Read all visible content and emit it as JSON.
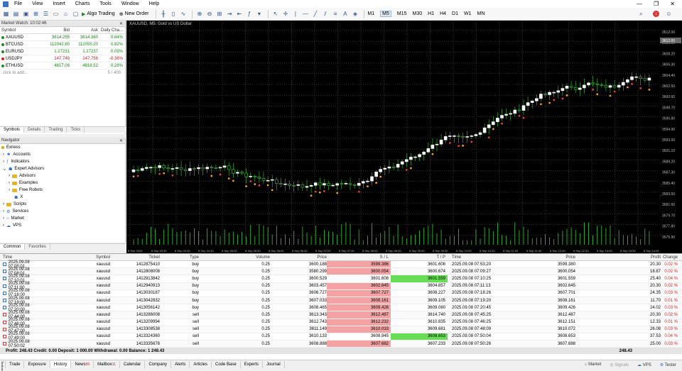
{
  "menu": [
    "File",
    "View",
    "Insert",
    "Charts",
    "Tools",
    "Window",
    "Help"
  ],
  "toolbar": {
    "algo": "Algo Trading",
    "neworder": "New Order",
    "timeframes": [
      "M1",
      "M5",
      "M15",
      "M30",
      "H1",
      "H4",
      "D1",
      "W1",
      "MN"
    ],
    "active_tf": "M5",
    "notifications": "1"
  },
  "market_watch": {
    "title": "Market Watch: 10:02:46",
    "headers": [
      "Symbol",
      "Bid",
      "Ask",
      "Daily Cha..."
    ],
    "rows": [
      {
        "symbol": "XAUUSD",
        "bid": "3614.255",
        "ask": "3614.360",
        "chg": "0.64%",
        "pos": true
      },
      {
        "symbol": "BTCUSD",
        "bid": "112042.60",
        "ask": "112055.20",
        "chg": "0.82%",
        "pos": true
      },
      {
        "symbol": "EURUSD",
        "bid": "1.17231",
        "ask": "1.17237",
        "chg": "0.09%",
        "pos": true
      },
      {
        "symbol": "USDJPY",
        "bid": "147.748",
        "ask": "147.756",
        "chg": "-0.36%",
        "pos": false
      },
      {
        "symbol": "ETHUSD",
        "bid": "4817.06",
        "ask": "4818.52",
        "chg": "0.28%",
        "pos": true
      }
    ],
    "add": "click to add...",
    "count": "5 / 400",
    "tabs": [
      "Symbols",
      "Details",
      "Trading",
      "Ticks"
    ]
  },
  "navigator": {
    "title": "Navigator",
    "root": "Exness",
    "items": [
      "Accounts",
      "Indicators",
      "Expert Advisors",
      "Advisors",
      "Examples",
      "Free Robots",
      "X",
      "Scripts",
      "Services",
      "Market",
      "VPS"
    ],
    "tabs": [
      "Common",
      "Favorites"
    ]
  },
  "chart": {
    "title": "XAUUSD, M5: Gold vs US Dollar",
    "prices": [
      "3612.00",
      "3610.10",
      "3608.20",
      "3606.30",
      "3604.40",
      "3602.50",
      "3600.60",
      "3598.70",
      "3596.80",
      "3594.90",
      "3593.00",
      "3591.10",
      "3589.20",
      "3587.30",
      "3585.40",
      "3583.50",
      "3581.60",
      "3579.70",
      "3577.80",
      "3575.90"
    ],
    "current": "3612.00",
    "times": [
      "8 Sep 2025",
      "8 Sep 03:30",
      "8 Sep 04:00",
      "8 Sep 04:30",
      "8 Sep 05:00",
      "8 Sep 05:30",
      "8 Sep 06:00",
      "8 Sep 06:30",
      "8 Sep 07:00",
      "8 Sep 07:30",
      "8 Sep 08:00",
      "8 Sep 08:30",
      "8 Sep 09:00",
      "8 Sep 09:30",
      "8 Sep 10:00",
      "8 Sep 10:30",
      "8 Sep 11:00",
      "8 Sep 11:30",
      "8 Sep 12:00",
      "8 Sep 12:30",
      "8 Sep 13:00",
      "8 Sep 13:30",
      "8 Sep 14:00"
    ]
  },
  "history": {
    "headers": [
      "Time",
      "Symbol",
      "Ticket",
      "Type",
      "Volume",
      "Price",
      "S / L",
      "T / P",
      "Time",
      "Price",
      "Profit",
      "Change"
    ],
    "rows": [
      [
        "2025.09.08 07:05:01",
        "xauusd",
        "1412875410",
        "buy",
        "0.25",
        "3600.188",
        "3599.386",
        "3601.608",
        "2025.09.08 07:53:20",
        "3599.380",
        "20.30",
        "0.02 %",
        "sl"
      ],
      [
        "2025.09.08 07:08:01",
        "xauusd",
        "1412808008",
        "buy",
        "0.25",
        "3580.299",
        "3600.054",
        "3600.674",
        "2025.09.08 07:09:27",
        "3600.054",
        "18.87",
        "0.02 %",
        "sl"
      ],
      [
        "2025.09.08 07:10:01",
        "xauusd",
        "1412913842",
        "buy",
        "0.25",
        "3600.529",
        "3601.608",
        "3601.559",
        "2025.09.08 07:10:25",
        "3601.559",
        "25.40",
        "0.04 %",
        "tp"
      ],
      [
        "2025.09.08 07:11:00",
        "xauusd",
        "1412940913",
        "buy",
        "0.25",
        "3603.457",
        "3602.645",
        "3604.857",
        "2025.09.08 07:11:13",
        "3602.645",
        "20.30",
        "0.02 %",
        "sl"
      ],
      [
        "2025.09.08 07:16:00",
        "xauusd",
        "1413030187",
        "buy",
        "0.25",
        "3606.727",
        "3607.727",
        "3608.227",
        "2025.09.08 07:18:26",
        "3607.701",
        "24.35",
        "0.03 %",
        "sl"
      ],
      [
        "2025.09.08 07:19:00",
        "xauusd",
        "1413042832",
        "buy",
        "0.25",
        "3607.033",
        "3608.161",
        "3609.105",
        "2025.09.08 07:19:20",
        "3608.161",
        "11.70",
        "0.01 %",
        "sl"
      ],
      [
        "2025.09.08 07:20:00",
        "xauusd",
        "1413056142",
        "buy",
        "0.25",
        "3608.465",
        "3609.426",
        "3609.080",
        "2025.09.08 07:20:45",
        "3609.426",
        "24.02",
        "0.03 %",
        "sl"
      ],
      [
        "2025.09.08 07:44:00",
        "xauusd",
        "1413286008",
        "sell",
        "0.25",
        "3613.343",
        "3612.487",
        "3614.740",
        "2025.09.08 07:45:25",
        "3612.487",
        "20.30",
        "0.02 %",
        "sl"
      ],
      [
        "2025.09.08 07:46:00",
        "xauusd",
        "1413209994",
        "sell",
        "0.25",
        "3612.743",
        "3612.232",
        "3610.835",
        "2025.09.08 07:46:25",
        "3612.151",
        "12.33",
        "0.01 %",
        "sl"
      ],
      [
        "2025.09.08 07:47:00",
        "xauusd",
        "1413308538",
        "sell",
        "0.25",
        "3611.149",
        "3610.033",
        "3609.681",
        "2025.09.08 07:48:09",
        "3610.072",
        "26.08",
        "0.03 %",
        "sl"
      ],
      [
        "2025.09.08 07:49:00",
        "xauusd",
        "1413324360",
        "sell",
        "0.25",
        "3610.133",
        "3608.945",
        "3608.653",
        "2025.09.08 07:50:04",
        "3608.653",
        "37.53",
        "0.04 %",
        "tp"
      ],
      [
        "2025.09.08 07:50:02",
        "xauusd",
        "1413335678",
        "sell",
        "0.25",
        "3608.888",
        "3607.682",
        "3607.233",
        "2025.09.08 07:50:26",
        "3607.688",
        "25.00",
        "0.03 %",
        "sl"
      ]
    ],
    "summary": "Profit: 248.43  Credit: 0.00  Deposit: 1 000.00  Withdrawal: 0.00  Balance: 1 248.43",
    "total": "248.43"
  },
  "bottom_tabs": [
    "Trade",
    "Exposure",
    "History",
    "News",
    "Mailbox",
    "Calendar",
    "Company",
    "Alerts",
    "Articles",
    "Code Base",
    "Experts",
    "Journal"
  ],
  "bottom_tab_badges": {
    "News": "99",
    "Mailbox": "11"
  },
  "bottom_right": [
    "Market",
    "Signals",
    "VPS",
    "Tester"
  ],
  "toolbox": "Toolbox"
}
